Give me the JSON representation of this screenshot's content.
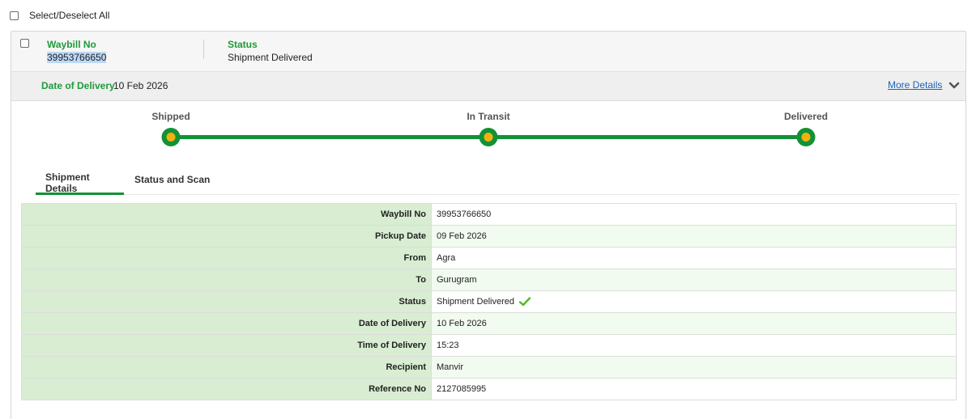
{
  "select_all": {
    "label": "Select/Deselect All"
  },
  "shipment": {
    "waybill_title": "Waybill No",
    "waybill_value": "39953766650",
    "status_title": "Status",
    "status_value": "Shipment Delivered"
  },
  "delivery_bar": {
    "label": "Date of Delivery",
    "value": "10 Feb 2026",
    "more_details": "More Details",
    "toggle_icon": "chevron-down-icon"
  },
  "tracker": {
    "stages": [
      "Shipped",
      "In Transit",
      "Delivered"
    ],
    "completed": 3,
    "colors": {
      "line": "#129137",
      "dot": "#f2b10f"
    }
  },
  "tabs": [
    {
      "label": "Shipment Details",
      "active": true
    },
    {
      "label": "Status and Scan",
      "active": false
    }
  ],
  "details": [
    {
      "key": "Waybill No",
      "value": "39953766650"
    },
    {
      "key": "Pickup Date",
      "value": "09 Feb 2026"
    },
    {
      "key": "From",
      "value": "Agra"
    },
    {
      "key": "To",
      "value": "Gurugram"
    },
    {
      "key": "Status",
      "value": "Shipment Delivered",
      "icon": "check-icon"
    },
    {
      "key": "Date of Delivery",
      "value": "10 Feb 2026"
    },
    {
      "key": "Time of Delivery",
      "value": "15:23"
    },
    {
      "key": "Recipient",
      "value": "Manvir"
    },
    {
      "key": "Reference No",
      "value": "2127085995"
    }
  ],
  "colors": {
    "accent": "#1f9a3a",
    "key_bg": "#d8edd2",
    "link": "#1a63b8"
  }
}
